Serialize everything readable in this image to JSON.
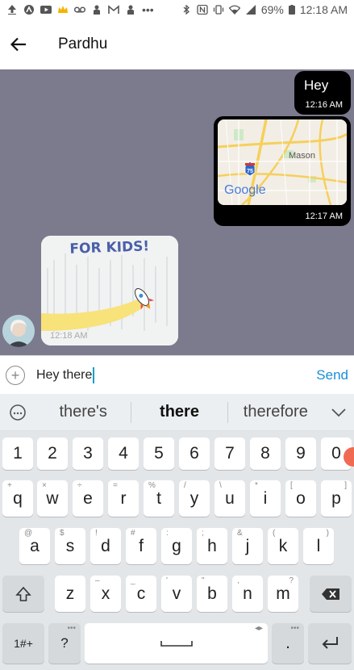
{
  "statusbar": {
    "battery": "69%",
    "time": "12:18 AM"
  },
  "header": {
    "title": "Pardhu"
  },
  "chat": {
    "messages": [
      {
        "text": "Hey",
        "time": "12:16 AM"
      },
      {
        "map_label": "Mason",
        "highway": "75",
        "brand": "Google",
        "time": "12:17 AM"
      },
      {
        "sticker_text": "FOR KIDS!",
        "time": "12:18 AM"
      }
    ]
  },
  "input": {
    "text": "Hey there",
    "send_label": "Send"
  },
  "suggestions": [
    "there's",
    "there",
    "therefore"
  ],
  "keyboard": {
    "row_numbers": [
      "1",
      "2",
      "3",
      "4",
      "5",
      "6",
      "7",
      "8",
      "9",
      "0"
    ],
    "row1": [
      "q",
      "w",
      "e",
      "r",
      "t",
      "y",
      "u",
      "i",
      "o",
      "p"
    ],
    "row1_hints": [
      "+",
      "×",
      "÷",
      "=",
      "%",
      "/",
      "\\",
      "*",
      "[",
      "]"
    ],
    "row2": [
      "a",
      "s",
      "d",
      "f",
      "g",
      "h",
      "j",
      "k",
      "l"
    ],
    "row2_hints": [
      "@",
      "$",
      "!",
      "#",
      ":",
      ";",
      "&",
      "(",
      ")"
    ],
    "row3": [
      "z",
      "x",
      "c",
      "v",
      "b",
      "n",
      "m"
    ],
    "row3_hints": [
      "–",
      "_",
      "'",
      "\"",
      ",",
      "?"
    ],
    "sym_label": "1#+",
    "q_label": "?",
    "dot_label": ".",
    "dots": "•••",
    "arrows": "◂▸"
  }
}
